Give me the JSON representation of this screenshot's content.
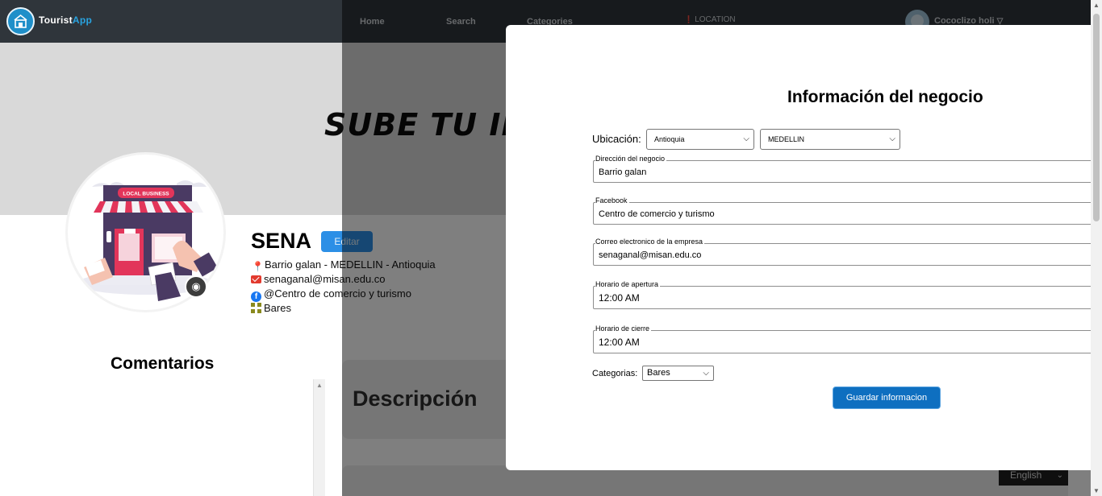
{
  "navbar": {
    "brand_main": "Tourist",
    "brand_accent": "App",
    "links": {
      "home": "Home",
      "search": "Search",
      "categories": "Categories",
      "location": "LOCATION"
    },
    "user_name": "Cococlizo holi",
    "user_caret": "▽"
  },
  "banner": {
    "text": "SUBE TU IM"
  },
  "profile": {
    "name": "SENA",
    "edit_label": "Editar",
    "address": "Barrio galan - MEDELLIN - Antioquia",
    "email": "senaganal@misan.edu.co",
    "facebook": "@Centro de comercio y turismo",
    "category": "Bares",
    "illustration_label": "LOCAL BUSINESS"
  },
  "comments": {
    "title": "Comentarios"
  },
  "description": {
    "title": "Descripción"
  },
  "language": {
    "selected": "English"
  },
  "modal": {
    "title": "Información del negocio",
    "location_label": "Ubicación:",
    "department": "Antioquia",
    "city": "MEDELLIN",
    "fields": {
      "address_label": "Dirección del negocio",
      "address_value": "Barrio galan",
      "facebook_label": "Facebook",
      "facebook_value": "Centro de comercio y turismo",
      "email_label": "Correo electronico de la empresa",
      "email_value": "senaganal@misan.edu.co",
      "open_label": "Horario de apertura",
      "open_value": "12:00  AM",
      "close_label": "Horario de cierre",
      "close_value": "12:00  AM"
    },
    "categories_label": "Categorias:",
    "category_value": "Bares",
    "save_label": "Guardar informacion"
  },
  "colors": {
    "navbar": "#2f353b",
    "brand_accent": "#29a3e0",
    "edit_button": "#2c8fe6",
    "save_button": "#0e6fc0",
    "facebook": "#1877f2",
    "email_icon": "#e23a2e",
    "pin": "#e01b1b"
  }
}
